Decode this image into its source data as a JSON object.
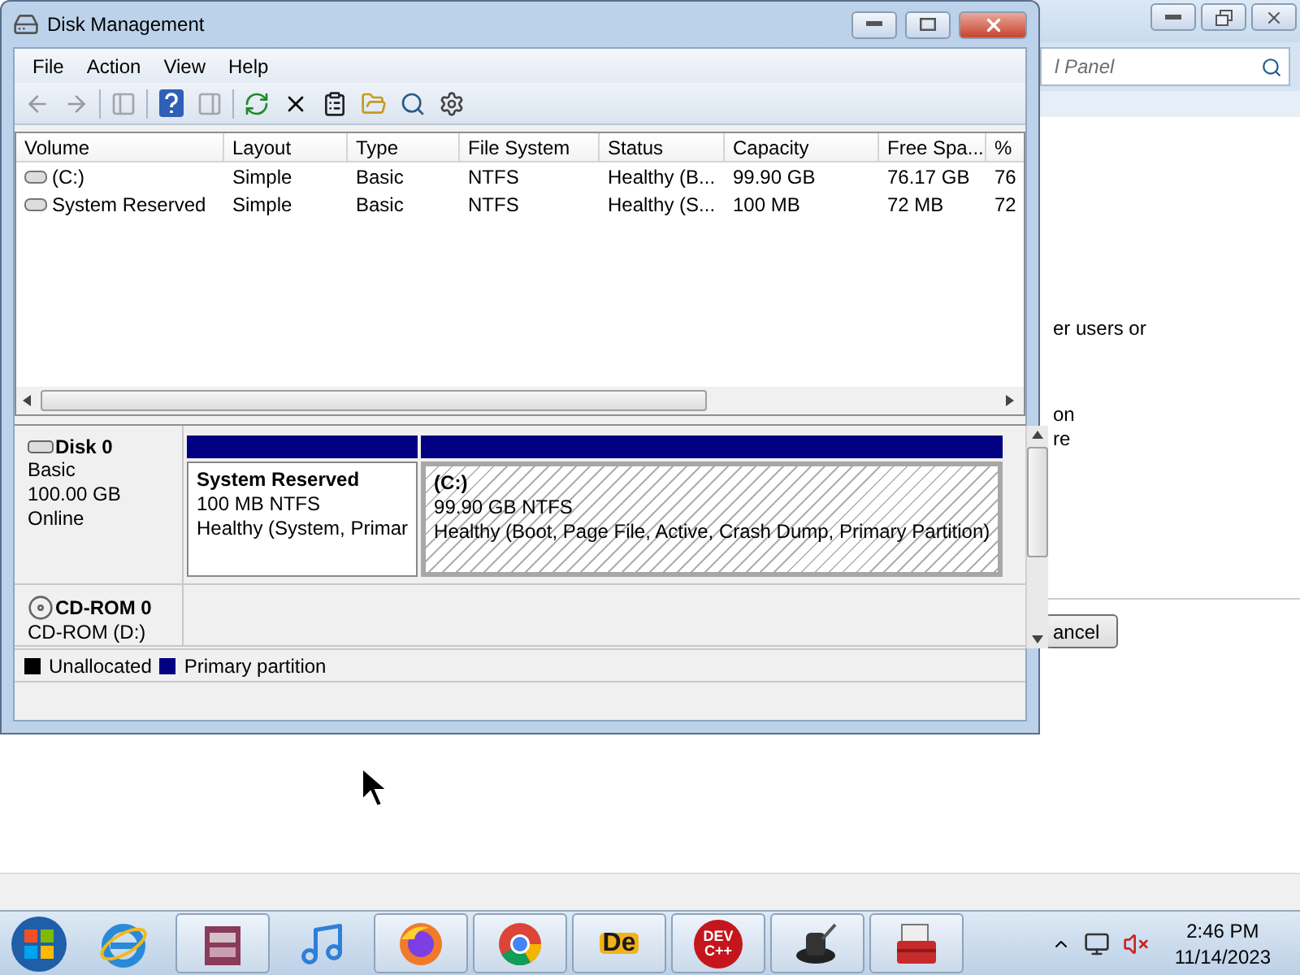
{
  "background_window": {
    "search_text": "l Panel",
    "lines": [
      "er users or",
      "on",
      "re"
    ],
    "button": "ancel"
  },
  "disk_window": {
    "title": "Disk Management",
    "menu": [
      "File",
      "Action",
      "View",
      "Help"
    ],
    "toolbar": [
      {
        "kind": "back",
        "disabled": true
      },
      {
        "kind": "forward",
        "disabled": true
      },
      {
        "kind": "sep"
      },
      {
        "kind": "tree",
        "disabled": true
      },
      {
        "kind": "sep"
      },
      {
        "kind": "help",
        "disabled": false
      },
      {
        "kind": "pane",
        "disabled": true
      },
      {
        "kind": "sep"
      },
      {
        "kind": "refresh",
        "disabled": false
      },
      {
        "kind": "delete",
        "disabled": false
      },
      {
        "kind": "properties",
        "disabled": false
      },
      {
        "kind": "open",
        "disabled": false
      },
      {
        "kind": "find",
        "disabled": false
      },
      {
        "kind": "settings",
        "disabled": false
      }
    ],
    "columns": [
      "Volume",
      "Layout",
      "Type",
      "File System",
      "Status",
      "Capacity",
      "Free Spa...",
      "%"
    ],
    "rows": [
      {
        "cells": [
          "(C:)",
          "Simple",
          "Basic",
          "NTFS",
          "Healthy (B...",
          "99.90 GB",
          "76.17 GB",
          "76"
        ]
      },
      {
        "cells": [
          "System Reserved",
          "Simple",
          "Basic",
          "NTFS",
          "Healthy (S...",
          "100 MB",
          "72 MB",
          "72"
        ]
      }
    ],
    "disks": [
      {
        "kind": "disk",
        "name": "Disk 0",
        "lines": [
          "Basic",
          "100.00 GB",
          "Online"
        ],
        "partitions": [
          {
            "name": "System Reserved",
            "size": "100 MB NTFS",
            "status": "Healthy (System, Primar",
            "selected": false
          },
          {
            "name": "(C:)",
            "size": "99.90 GB NTFS",
            "status": "Healthy (Boot, Page File, Active, Crash Dump, Primary Partition)",
            "selected": true
          }
        ]
      },
      {
        "kind": "cdrom",
        "name": "CD-ROM 0",
        "lines": [
          "CD-ROM (D:)"
        ]
      }
    ],
    "legend": [
      {
        "label": "Unallocated",
        "color": "#000000"
      },
      {
        "label": "Primary partition",
        "color": "#000080"
      }
    ]
  },
  "taskbar": {
    "items": [
      {
        "kind": "ie",
        "boxed": false
      },
      {
        "kind": "archive",
        "boxed": true
      },
      {
        "kind": "music",
        "boxed": false
      },
      {
        "kind": "firefox",
        "boxed": true
      },
      {
        "kind": "chrome",
        "boxed": true
      },
      {
        "kind": "de",
        "label": "De",
        "boxed": true
      },
      {
        "kind": "dev",
        "label": "DEV C++",
        "boxed": true
      },
      {
        "kind": "hat",
        "boxed": true
      },
      {
        "kind": "toolbox",
        "boxed": true
      }
    ],
    "time": "2:46 PM",
    "date": "11/14/2023"
  }
}
